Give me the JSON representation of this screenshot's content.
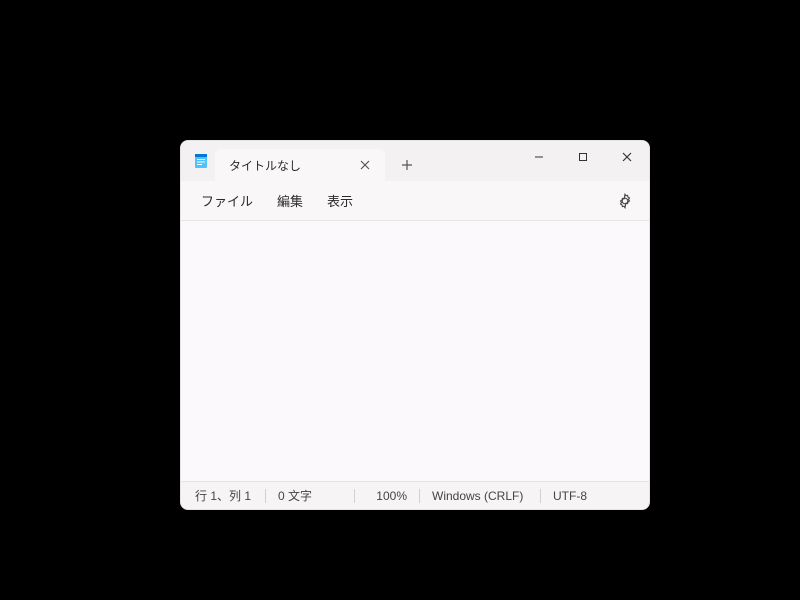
{
  "window": {
    "tab_title": "タイトルなし"
  },
  "menu": {
    "file": "ファイル",
    "edit": "編集",
    "view": "表示"
  },
  "editor": {
    "content": ""
  },
  "status": {
    "position": "行 1、列 1",
    "char_count": "0 文字",
    "zoom": "100%",
    "line_ending": "Windows (CRLF)",
    "encoding": "UTF-8"
  }
}
